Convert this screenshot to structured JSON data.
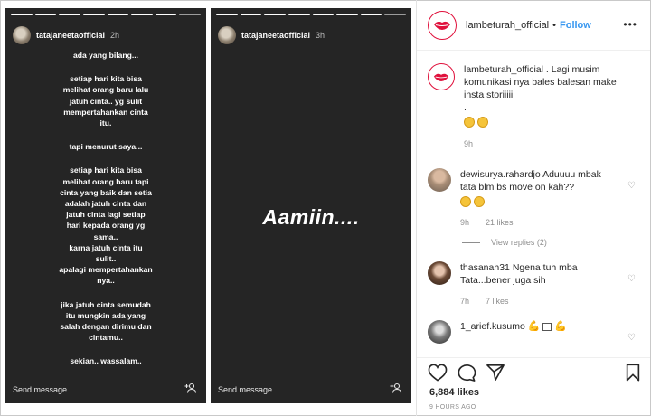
{
  "story_left": {
    "username": "tatajaneetaofficial",
    "time": "2h",
    "lines": [
      "ada yang bilang...",
      "",
      "setiap hari kita bisa",
      "melihat orang baru lalu",
      "jatuh cinta.. yg sulit",
      "mempertahankan cinta",
      "itu.",
      "",
      "tapi menurut saya...",
      "",
      "setiap hari kita bisa",
      "melihat orang baru tapi",
      "cinta yang baik dan setia",
      "adalah jatuh cinta dan",
      "jatuh cinta lagi setiap",
      "hari kepada orang yg",
      "sama..",
      "karna jatuh cinta itu",
      "sulit..",
      "apalagi mempertahankan",
      "nya..",
      "",
      "jika jatuh cinta semudah",
      "itu mungkin ada yang",
      "salah dengan dirimu dan",
      "cintamu..",
      "",
      "sekian.. wassalam.."
    ],
    "send_message": "Send message"
  },
  "story_right": {
    "username": "tatajaneetaofficial",
    "time": "3h",
    "big_text": "Aamiin....",
    "send_message": "Send message"
  },
  "post": {
    "author": "lambeturah_official",
    "follow_label": "Follow",
    "caption_user": "lambeturah_official",
    "caption_text": ". Lagi musim komunikasi nya bales balesan make insta storiiiii",
    "caption_dot": ".",
    "caption_time": "9h",
    "comments": [
      {
        "user": "dewisurya.rahardjo",
        "text": "Aduuuu mbak tata blm bs move on kah??",
        "time": "9h",
        "likes": "21 likes",
        "view_replies": "View replies (2)"
      },
      {
        "user": "thasanah31",
        "text": "Ngena tuh mba Tata...bener juga sih",
        "time": "7h",
        "likes": "7 likes"
      },
      {
        "user": "1_arief.kusumo",
        "text": ""
      }
    ],
    "likes_count": "6,884 likes",
    "time_ago": "9 HOURS AGO"
  },
  "colors": {
    "story_bg": "#252525",
    "follow_blue": "#3897f0",
    "brand_red": "#e0113c"
  },
  "icons": [
    "person-add-icon",
    "heart-icon",
    "comment-icon",
    "share-icon",
    "bookmark-icon",
    "more-icon",
    "lips-logo-icon",
    "flexed-biceps-emoji",
    "grinning-emoji"
  ]
}
